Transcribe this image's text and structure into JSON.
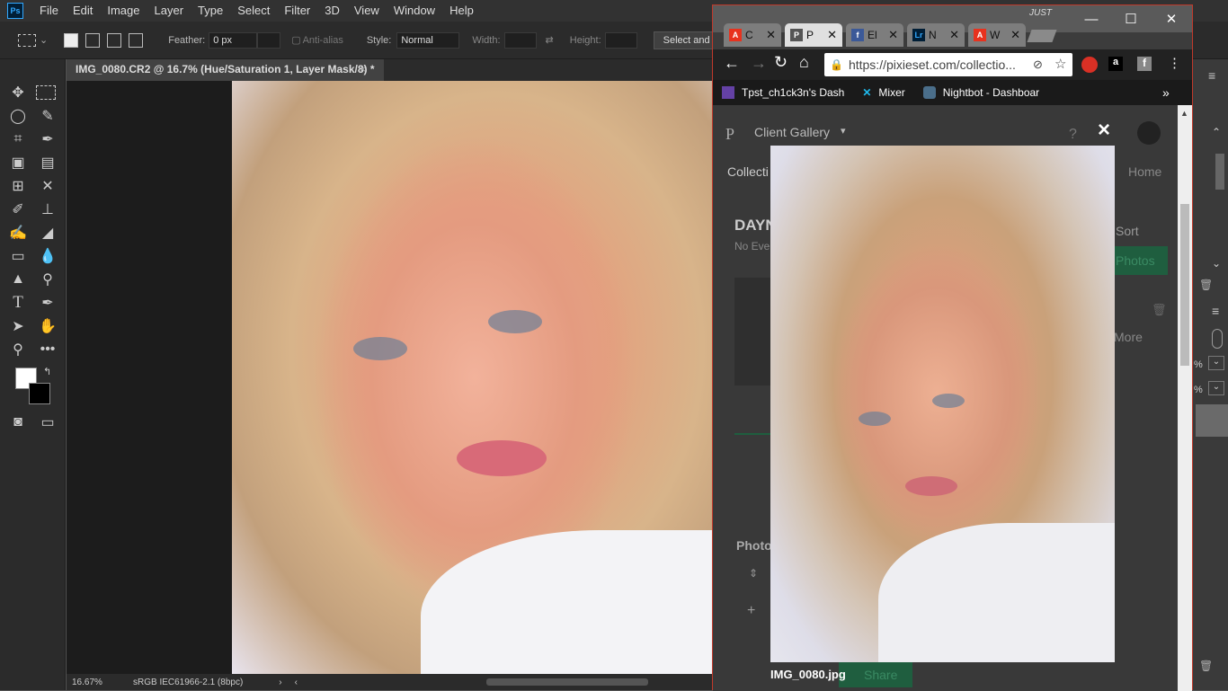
{
  "ps": {
    "logo": "Ps",
    "menu": [
      "File",
      "Edit",
      "Image",
      "Layer",
      "Type",
      "Select",
      "Filter",
      "3D",
      "View",
      "Window",
      "Help"
    ],
    "options": {
      "feather_label": "Feather:",
      "feather_value": "0 px",
      "antialias_label": "Anti-alias",
      "style_label": "Style:",
      "style_value": "Normal",
      "width_label": "Width:",
      "height_label": "Height:",
      "select_mask_label": "Select and Mas"
    },
    "doc_tab": "IMG_0080.CR2 @ 16.7% (Hue/Saturation 1, Layer Mask/8) *",
    "status": {
      "zoom": "16.67%",
      "profile": "sRGB IEC61966-2.1 (8bpc)"
    },
    "right_values": [
      "%",
      "%"
    ]
  },
  "chrome": {
    "tabs": [
      {
        "title": "C",
        "icon": "adobe-icon",
        "color": "#e8321e"
      },
      {
        "title": "P",
        "icon": "pixieset-icon",
        "color": "#555555"
      },
      {
        "title": "El",
        "icon": "facebook-icon",
        "color": "#3b5998"
      },
      {
        "title": "N",
        "icon": "lightroom-icon",
        "color": "#001e36"
      },
      {
        "title": "W",
        "icon": "adobe-icon",
        "color": "#e8321e"
      }
    ],
    "profile_name": "JUST",
    "url": "https://pixieset.com/collectio...",
    "bookmarks": [
      {
        "label": "Tpst_ch1ck3n's Dash",
        "icon": "twitch-icon"
      },
      {
        "label": "Mixer",
        "icon": "mixer-icon"
      },
      {
        "label": "Nightbot - Dashboar",
        "icon": "nightbot-icon"
      }
    ],
    "more_bookmarks": "»"
  },
  "pixieset": {
    "logo": "P",
    "client_gallery": "Client Gallery",
    "help": "?",
    "nav_left": "Collecti",
    "nav_right": "Home",
    "heading": "DAYN",
    "subheading": "No Eve",
    "sort": "Sort",
    "photos_btn": "Photos",
    "more": "More",
    "photos_section": "Photo",
    "share": "Share",
    "filename": "IMG_0080.jpg",
    "close": "×"
  }
}
